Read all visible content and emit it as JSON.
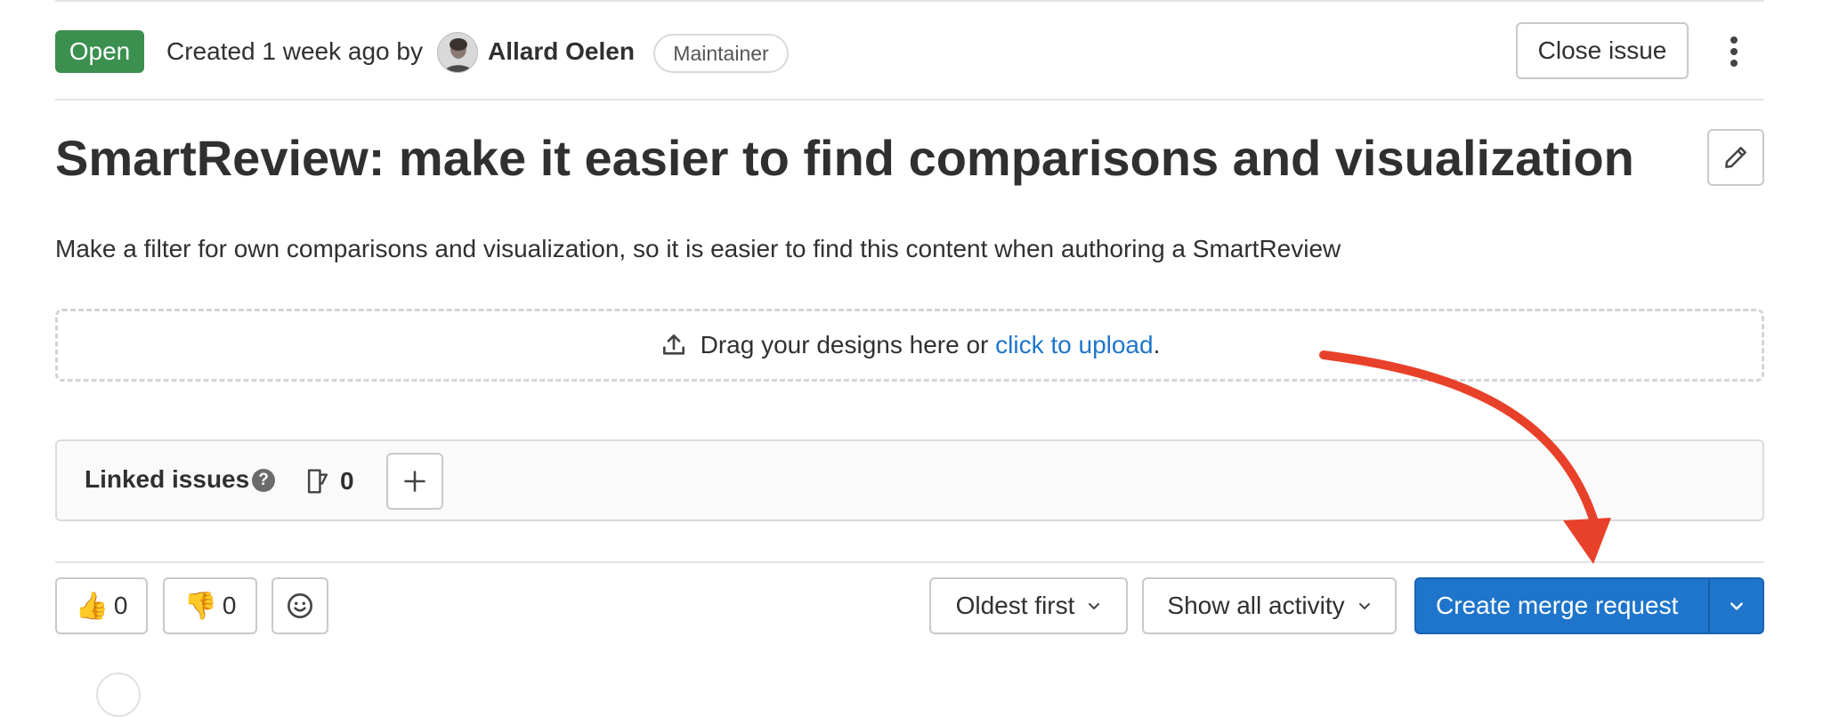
{
  "header": {
    "status": "Open",
    "created_text": "Created 1 week ago by",
    "author": "Allard Oelen",
    "role": "Maintainer",
    "close_button": "Close issue"
  },
  "issue": {
    "title": "SmartReview: make it easier to find comparisons and visualization",
    "description": "Make a filter for own comparisons and visualization, so it is easier to find this content when authoring a SmartReview"
  },
  "designs": {
    "prefix": "Drag your designs here or ",
    "link": "click to upload",
    "suffix": "."
  },
  "linked_issues": {
    "title": "Linked issues",
    "count": "0"
  },
  "reactions": {
    "thumbs_up_count": "0",
    "thumbs_down_count": "0"
  },
  "activity": {
    "sort_label": "Oldest first",
    "filter_label": "Show all activity"
  },
  "merge_request": {
    "button_label": "Create merge request"
  },
  "colors": {
    "status_open": "#3b8f4f",
    "primary": "#1f75cb",
    "link": "#1f75cb",
    "annotation_arrow": "#e8412a"
  }
}
